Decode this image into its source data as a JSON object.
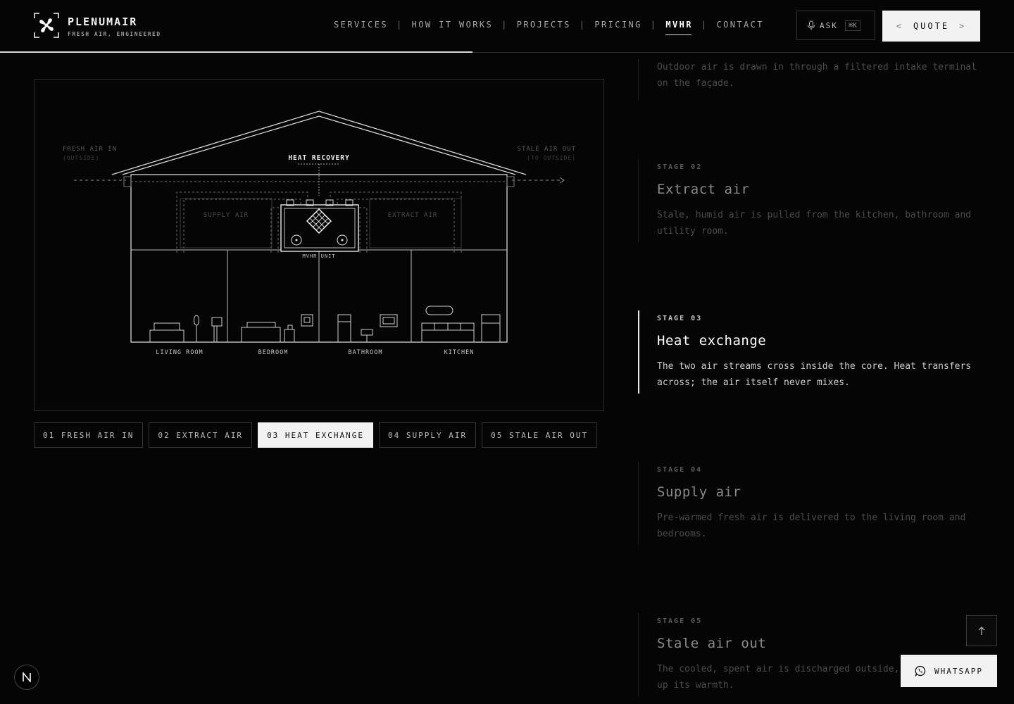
{
  "brand": {
    "name": "PLENUMAIR",
    "tagline": "FRESH AIR, ENGINEERED",
    "logo_icon": "fan-icon"
  },
  "nav": {
    "items": [
      {
        "label": "SERVICES",
        "active": false
      },
      {
        "label": "HOW IT WORKS",
        "active": false
      },
      {
        "label": "PROJECTS",
        "active": false
      },
      {
        "label": "PRICING",
        "active": false
      },
      {
        "label": "MVHR",
        "active": true
      },
      {
        "label": "CONTACT",
        "active": false
      }
    ],
    "separator": "|"
  },
  "header_actions": {
    "ask_label": "ASK",
    "ask_shortcut": "⌘K",
    "ask_icon": "microphone-icon",
    "quote_label": "QUOTE",
    "quote_left": "<",
    "quote_right": ">"
  },
  "diagram": {
    "fresh_air_label": "FRESH AIR IN",
    "fresh_air_sub": "(OUTSIDE)",
    "stale_air_label": "STALE AIR OUT",
    "stale_air_sub": "(TO OUTSIDE)",
    "heat_recovery_label": "HEAT RECOVERY",
    "supply_label": "SUPPLY AIR",
    "extract_label": "EXTRACT AIR",
    "unit_label": "MVHR UNIT",
    "rooms": [
      "LIVING ROOM",
      "BEDROOM",
      "BATHROOM",
      "KITCHEN"
    ]
  },
  "stage_tabs": [
    {
      "label": "01 FRESH AIR IN",
      "active": false
    },
    {
      "label": "02 EXTRACT AIR",
      "active": false
    },
    {
      "label": "03 HEAT EXCHANGE",
      "active": true
    },
    {
      "label": "04 SUPPLY AIR",
      "active": false
    },
    {
      "label": "05 STALE AIR OUT",
      "active": false
    }
  ],
  "stages": [
    {
      "label": "",
      "title": "",
      "desc": "Outdoor air is drawn in through a filtered intake terminal on the façade.",
      "active": false
    },
    {
      "label": "STAGE 02",
      "title": "Extract air",
      "desc": "Stale, humid air is pulled from the kitchen, bathroom and utility room.",
      "active": false
    },
    {
      "label": "STAGE 03",
      "title": "Heat exchange",
      "desc": "The two air streams cross inside the core. Heat transfers across; the air itself never mixes.",
      "active": true
    },
    {
      "label": "STAGE 04",
      "title": "Supply air",
      "desc": "Pre-warmed fresh air is delivered to the living room and bedrooms.",
      "active": false
    },
    {
      "label": "STAGE 05",
      "title": "Stale air out",
      "desc": "The cooled, spent air is discharged outside, having given up its warmth.",
      "active": false
    }
  ],
  "floating": {
    "whatsapp_label": "WHATSAPP",
    "whatsapp_icon": "whatsapp-icon",
    "scroll_icon": "arrow-up-icon",
    "badge_letter": "N"
  },
  "scroll_progress": 0.466
}
